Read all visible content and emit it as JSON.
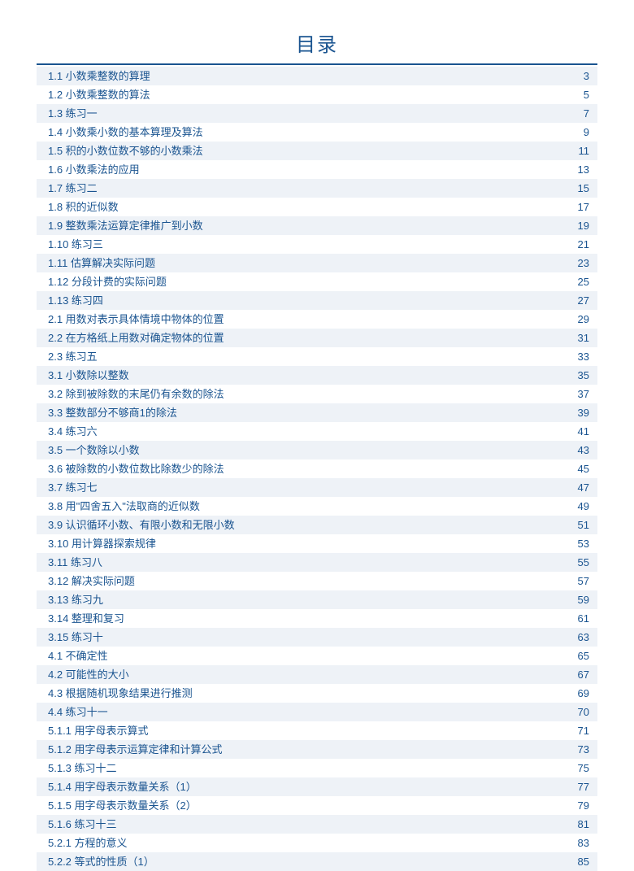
{
  "title": "目录",
  "toc": [
    {
      "num": "1.1",
      "label": "小数乘整数的算理",
      "page": "3"
    },
    {
      "num": "1.2",
      "label": "小数乘整数的算法",
      "page": "5"
    },
    {
      "num": "1.3",
      "label": "练习一",
      "page": "7"
    },
    {
      "num": "1.4",
      "label": "小数乘小数的基本算理及算法",
      "page": "9"
    },
    {
      "num": "1.5",
      "label": "积的小数位数不够的小数乘法",
      "page": "11"
    },
    {
      "num": "1.6",
      "label": "小数乘法的应用",
      "page": "13"
    },
    {
      "num": "1.7",
      "label": "练习二",
      "page": "15"
    },
    {
      "num": "1.8",
      "label": "积的近似数",
      "page": "17"
    },
    {
      "num": "1.9",
      "label": "整数乘法运算定律推广到小数",
      "page": "19"
    },
    {
      "num": "1.10",
      "label": "练习三",
      "page": "21"
    },
    {
      "num": "1.11",
      "label": "估算解决实际问题",
      "page": "23"
    },
    {
      "num": "1.12",
      "label": "分段计费的实际问题",
      "page": "25"
    },
    {
      "num": "1.13",
      "label": "练习四",
      "page": "27"
    },
    {
      "num": "2.1",
      "label": "用数对表示具体情境中物体的位置",
      "page": "29"
    },
    {
      "num": "2.2",
      "label": "在方格纸上用数对确定物体的位置",
      "page": "31"
    },
    {
      "num": "2.3",
      "label": "练习五",
      "page": "33"
    },
    {
      "num": "3.1",
      "label": "小数除以整数",
      "page": "35"
    },
    {
      "num": "3.2",
      "label": "除到被除数的末尾仍有余数的除法",
      "page": "37"
    },
    {
      "num": "3.3",
      "label": "整数部分不够商1的除法",
      "page": "39"
    },
    {
      "num": "3.4",
      "label": "练习六",
      "page": "41"
    },
    {
      "num": "3.5",
      "label": "一个数除以小数",
      "page": "43"
    },
    {
      "num": "3.6",
      "label": "被除数的小数位数比除数少的除法",
      "page": "45"
    },
    {
      "num": "3.7",
      "label": "练习七",
      "page": "47"
    },
    {
      "num": "3.8",
      "label": "用\"四舍五入\"法取商的近似数",
      "page": "49"
    },
    {
      "num": "3.9",
      "label": "认识循环小数、有限小数和无限小数",
      "page": "51"
    },
    {
      "num": "3.10",
      "label": "用计算器探索规律",
      "page": "53"
    },
    {
      "num": "3.11",
      "label": "练习八",
      "page": "55"
    },
    {
      "num": "3.12",
      "label": "解决实际问题",
      "page": "57"
    },
    {
      "num": "3.13",
      "label": "练习九",
      "page": "59"
    },
    {
      "num": "3.14",
      "label": "整理和复习",
      "page": "61"
    },
    {
      "num": "3.15",
      "label": "练习十",
      "page": "63"
    },
    {
      "num": "4.1",
      "label": "不确定性",
      "page": "65"
    },
    {
      "num": "4.2",
      "label": "可能性的大小",
      "page": "67"
    },
    {
      "num": "4.3",
      "label": "根据随机现象结果进行推测",
      "page": "69"
    },
    {
      "num": "4.4",
      "label": "练习十一",
      "page": "70"
    },
    {
      "num": "5.1.1",
      "label": "用字母表示算式",
      "page": "71"
    },
    {
      "num": "5.1.2",
      "label": "用字母表示运算定律和计算公式",
      "page": "73"
    },
    {
      "num": "5.1.3",
      "label": "练习十二",
      "page": "75"
    },
    {
      "num": "5.1.4",
      "label": "用字母表示数量关系（1）",
      "page": "77"
    },
    {
      "num": "5.1.5",
      "label": "用字母表示数量关系（2）",
      "page": "79"
    },
    {
      "num": "5.1.6",
      "label": "练习十三",
      "page": "81"
    },
    {
      "num": "5.2.1",
      "label": "方程的意义",
      "page": "83"
    },
    {
      "num": "5.2.2",
      "label": "等式的性质（1）",
      "page": "85"
    }
  ]
}
